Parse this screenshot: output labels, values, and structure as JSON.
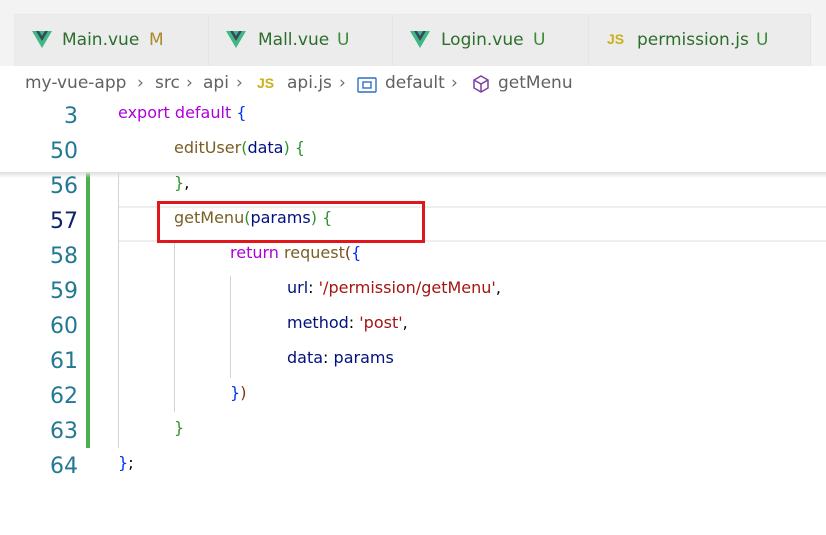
{
  "tabs": [
    {
      "icon": "vue-icon",
      "label": "Main.vue",
      "status": "M",
      "status_color": "#a98a2b"
    },
    {
      "icon": "vue-icon",
      "label": "Mall.vue",
      "status": "U",
      "status_color": "#3d8a3d"
    },
    {
      "icon": "vue-icon",
      "label": "Login.vue",
      "status": "U",
      "status_color": "#3d8a3d"
    },
    {
      "icon": "js-icon",
      "icon_text": "JS",
      "label": "permission.js",
      "status": "U",
      "status_color": "#3d8a3d"
    }
  ],
  "breadcrumb": {
    "root": "my-vue-app",
    "folder1": "src",
    "folder2": "api",
    "file_icon_text": "JS",
    "file": "api.js",
    "symbol1": "default",
    "symbol2": "getMenu"
  },
  "editor": {
    "lines": [
      {
        "number": "3",
        "tokens": [
          "export",
          "default",
          "{"
        ]
      },
      {
        "number": "50",
        "tokens": [
          "editUser",
          "(",
          "data",
          ")",
          "{"
        ]
      },
      {
        "number": "56",
        "tokens": [
          "}",
          ","
        ]
      },
      {
        "number": "57",
        "tokens": [
          "getMenu",
          "(",
          "params",
          ")",
          "{"
        ]
      },
      {
        "number": "58",
        "tokens": [
          "return",
          "request",
          "(",
          "{"
        ]
      },
      {
        "number": "59",
        "tokens": [
          "url",
          ": ",
          "'/permission/getMenu'",
          ","
        ]
      },
      {
        "number": "60",
        "tokens": [
          "method",
          ": ",
          "'post'",
          ","
        ]
      },
      {
        "number": "61",
        "tokens": [
          "data",
          ": ",
          "params"
        ]
      },
      {
        "number": "62",
        "tokens": [
          "}",
          ")"
        ]
      },
      {
        "number": "63",
        "tokens": [
          "}"
        ]
      },
      {
        "number": "64",
        "tokens": [
          "}",
          ";"
        ]
      }
    ]
  },
  "colors": {
    "highlight_box": "#e0161b",
    "added_lines_bar": "#4caf50",
    "keyword": "#af00db",
    "function": "#795e26",
    "string": "#a31515"
  }
}
